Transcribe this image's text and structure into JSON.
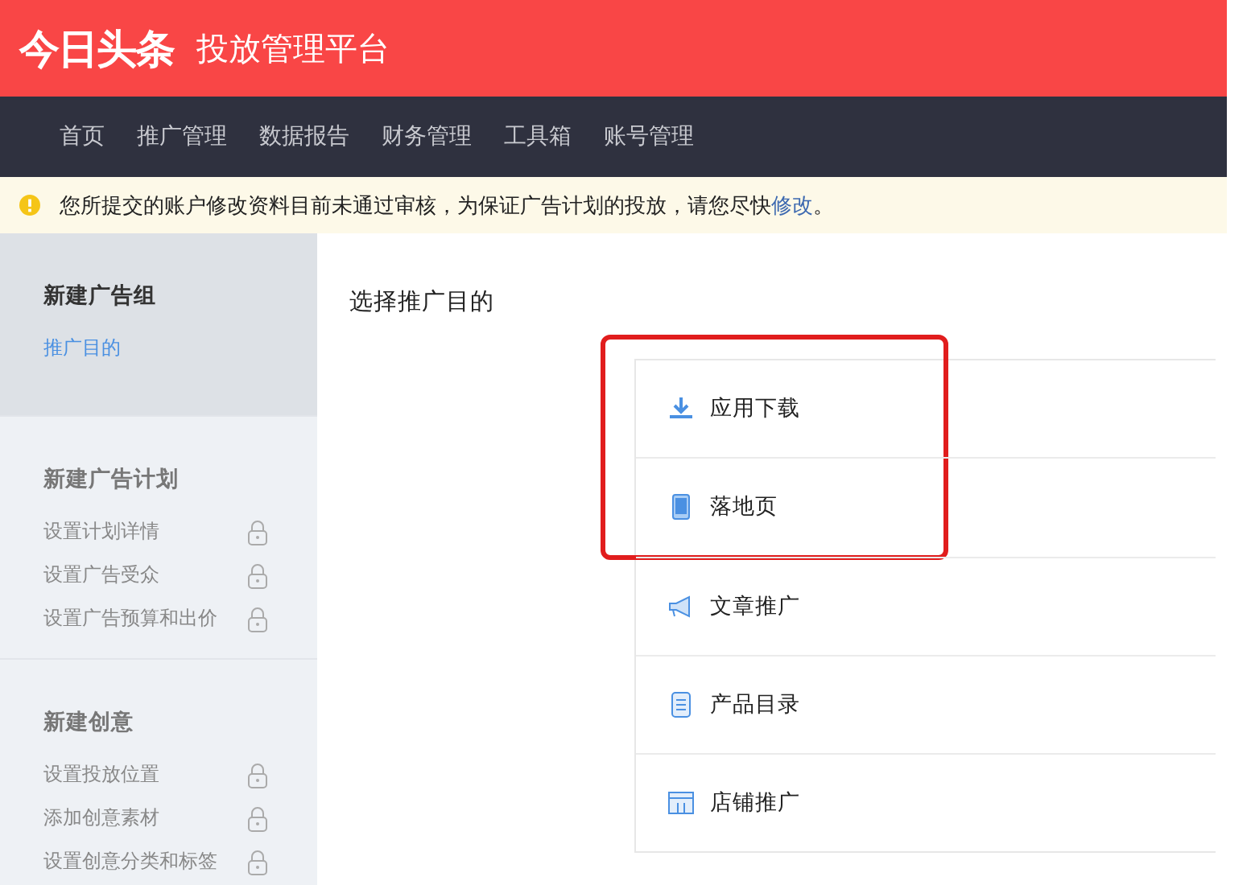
{
  "header": {
    "logo": "今日头条",
    "title": "投放管理平台"
  },
  "nav": [
    {
      "label": "首页"
    },
    {
      "label": "推广管理"
    },
    {
      "label": "数据报告"
    },
    {
      "label": "财务管理"
    },
    {
      "label": "工具箱"
    },
    {
      "label": "账号管理"
    }
  ],
  "notice": {
    "text": "您所提交的账户修改资料目前未通过审核，为保证广告计划的投放，请您尽快",
    "link": "修改",
    "end": "。"
  },
  "sidebar": [
    {
      "title": "新建广告组",
      "active": true,
      "items": [
        {
          "label": "推广目的",
          "locked": false,
          "selected": true
        }
      ]
    },
    {
      "title": "新建广告计划",
      "active": false,
      "items": [
        {
          "label": "设置计划详情",
          "locked": true,
          "selected": false
        },
        {
          "label": "设置广告受众",
          "locked": true,
          "selected": false
        },
        {
          "label": "设置广告预算和出价",
          "locked": true,
          "selected": false
        }
      ]
    },
    {
      "title": "新建创意",
      "active": false,
      "items": [
        {
          "label": "设置投放位置",
          "locked": true,
          "selected": false
        },
        {
          "label": "添加创意素材",
          "locked": true,
          "selected": false
        },
        {
          "label": "设置创意分类和标签",
          "locked": true,
          "selected": false
        }
      ]
    }
  ],
  "content": {
    "heading": "选择推广目的",
    "options": [
      {
        "label": "应用下载",
        "kind": "download",
        "highlighted": true
      },
      {
        "label": "落地页",
        "kind": "phone",
        "highlighted": true
      },
      {
        "label": "文章推广",
        "kind": "megaphone",
        "highlighted": false
      },
      {
        "label": "产品目录",
        "kind": "list",
        "highlighted": false
      },
      {
        "label": "店铺推广",
        "kind": "store",
        "highlighted": false
      }
    ]
  }
}
